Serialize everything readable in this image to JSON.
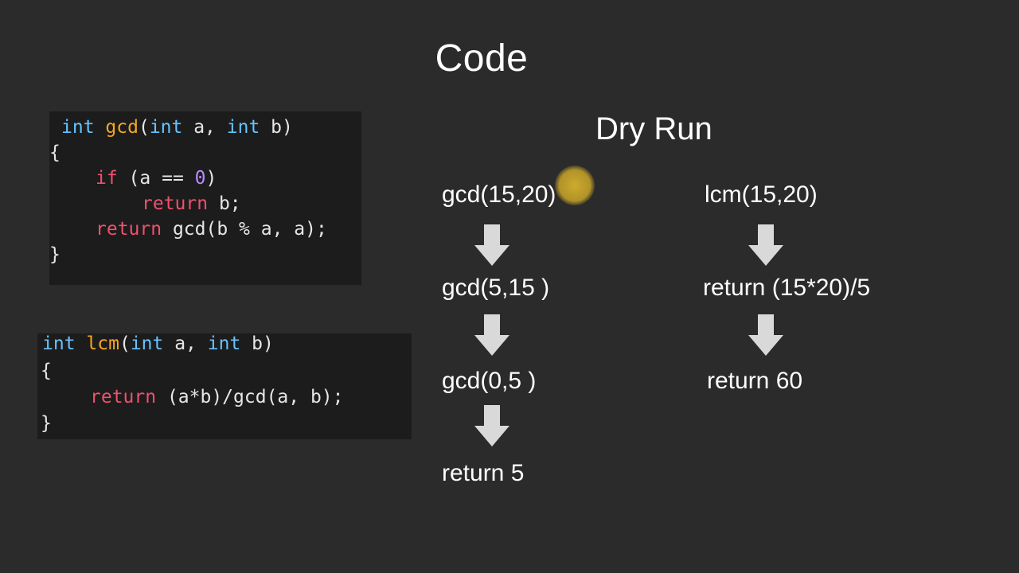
{
  "title": "Code",
  "code": {
    "gcd": {
      "line1": {
        "t1": "int",
        "t2": " ",
        "fn": "gcd",
        "t3": "(",
        "t4": "int",
        "t5": " a, ",
        "t6": "int",
        "t7": " b)"
      },
      "line2": "{",
      "line3": {
        "ctrl": "if",
        "rest1": " (a == ",
        "num": "0",
        "rest2": ")"
      },
      "line4": {
        "ctrl": "return",
        "rest": " b;"
      },
      "line5": {
        "ctrl": "return",
        "rest": " gcd(b % a, a);"
      },
      "line6": "}"
    },
    "lcm": {
      "line1": {
        "t1": "int",
        "t2": " ",
        "fn": "lcm",
        "t3": "(",
        "t4": "int",
        "t5": " a, ",
        "t6": "int",
        "t7": " b)"
      },
      "line2": "{",
      "line3": {
        "ctrl": "return",
        "rest": " (a*b)/gcd(a, b);"
      },
      "line4": "}"
    }
  },
  "dry_run": {
    "title": "Dry Run",
    "gcd_steps": [
      "gcd(15,20)",
      "gcd(5,15 )",
      "gcd(0,5 )",
      "return 5"
    ],
    "lcm_steps": [
      "lcm(15,20)",
      "return (15*20)/5",
      "return 60"
    ]
  },
  "colors": {
    "background": "#2b2b2b",
    "code_background": "#1c1c1c",
    "keyword_type": "#66c2ff",
    "keyword_control": "#f0506e",
    "function": "#f5a623",
    "number": "#b58cff",
    "arrow": "#d9d9d9",
    "cursor_highlight": "#d6b22e"
  }
}
